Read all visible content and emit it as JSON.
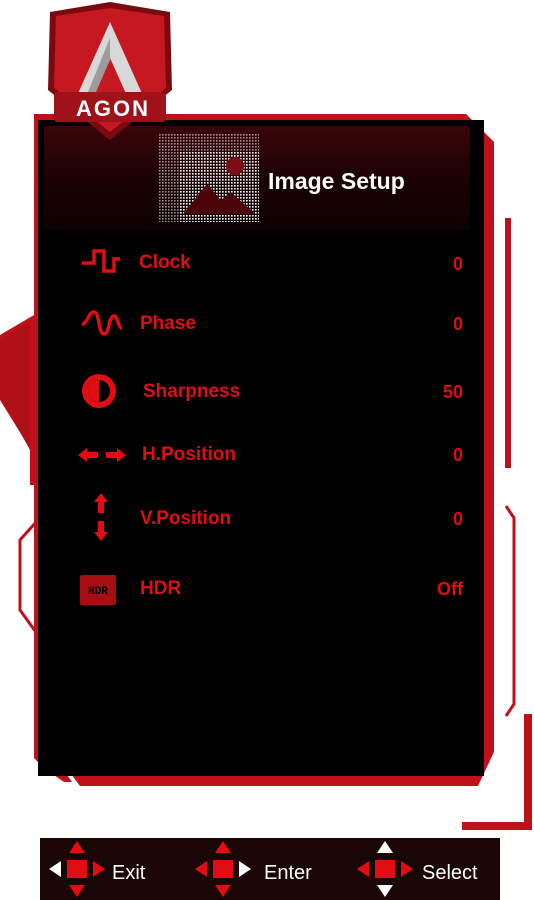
{
  "brand": {
    "logo_text": "AGON"
  },
  "menu": {
    "title": "Image Setup",
    "items": [
      {
        "label": "Clock",
        "value": "0",
        "icon": "clock-waveform-icon"
      },
      {
        "label": "Phase",
        "value": "0",
        "icon": "phase-wave-icon"
      },
      {
        "label": "Sharpness",
        "value": "50",
        "icon": "sharpness-circle-icon"
      },
      {
        "label": "H.Position",
        "value": "0",
        "icon": "horizontal-arrows-icon"
      },
      {
        "label": "V.Position",
        "value": "0",
        "icon": "vertical-arrows-icon"
      },
      {
        "label": "HDR",
        "value": "Off",
        "icon": "hdr-icon"
      }
    ]
  },
  "footer": {
    "exit_label": "Exit",
    "enter_label": "Enter",
    "select_label": "Select"
  },
  "colors": {
    "accent": "#e00d12",
    "background": "#000000",
    "frame": "#c0111a"
  }
}
